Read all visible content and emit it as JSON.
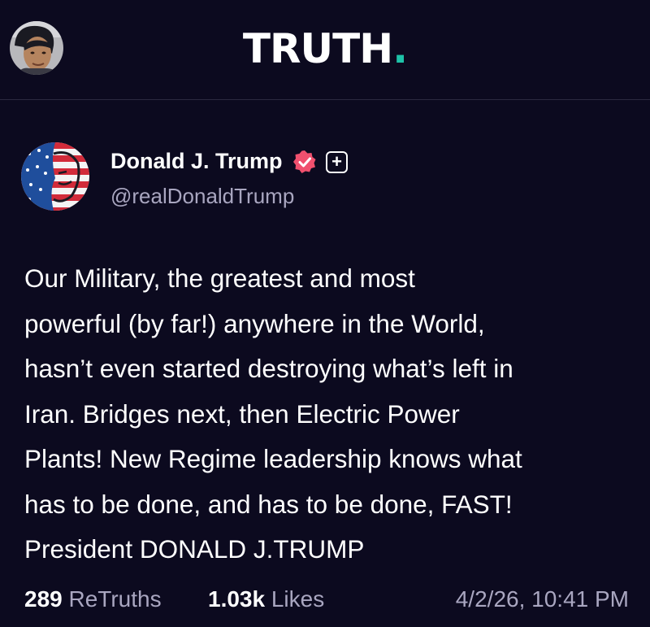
{
  "header": {
    "logo_text": "TRUTH",
    "logo_dot": ".",
    "user_avatar_icon": "user-avatar-photo"
  },
  "post": {
    "author": {
      "name": "Donald J. Trump",
      "handle": "@realDonaldTrump",
      "verified_icon": "verified-badge-icon",
      "plus_label": "+"
    },
    "body_lines": [
      "Our Military, the greatest and most",
      "powerful (by far!) anywhere in the World,",
      "hasn’t even started destroying what’s left in",
      "Iran. Bridges next, then Electric Power",
      "Plants! New Regime leadership knows what",
      "has to be done, and has to be done, FAST!",
      "President DONALD J.TRUMP"
    ],
    "stats": {
      "retruths_count": "289",
      "retruths_label": "ReTruths",
      "likes_count": "1.03k",
      "likes_label": "Likes",
      "timestamp": "4/2/26, 10:41 PM"
    }
  },
  "colors": {
    "background": "#0c0a1f",
    "accent_teal": "#1ec2a8",
    "muted_text": "#a9a6c0",
    "verified_pink": "#f0506e"
  }
}
